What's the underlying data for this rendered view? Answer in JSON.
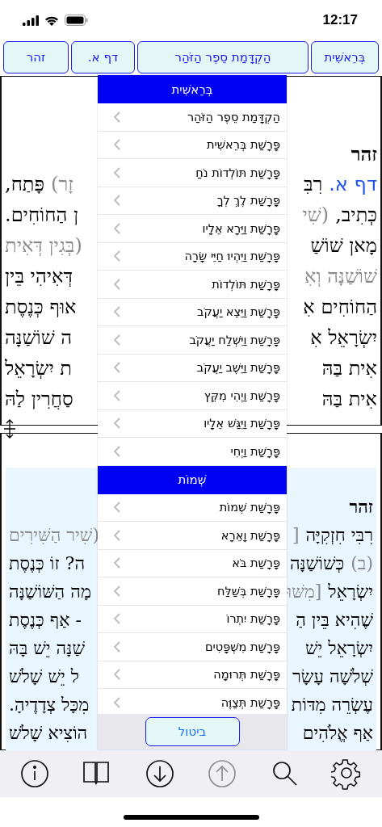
{
  "status_bar": {
    "time": "12:17"
  },
  "nav_buttons": [
    {
      "label": "בְּרֵאשִׁית"
    },
    {
      "label": "הַקְדָּמַת סֵפֶר הַזֹּהַר"
    },
    {
      "label": "דף א."
    },
    {
      "label": "זהר"
    }
  ],
  "upper_pane": {
    "lines": [
      {
        "right": [
          {
            "kind": "heading",
            "text": "זהר"
          }
        ]
      },
      {
        "right": [
          {
            "kind": "ref",
            "text": "דף א."
          },
          {
            "kind": "text",
            "text": "רִבִּ"
          }
        ],
        "left": [
          {
            "kind": "note",
            "text": "זָר)"
          },
          {
            "kind": "text",
            "text": "פָּתַח,"
          }
        ]
      },
      {
        "right": [
          {
            "kind": "text",
            "text": "כְּתִיב,"
          },
          {
            "kind": "note",
            "text": "(שִׁי"
          }
        ],
        "left": [
          {
            "kind": "text",
            "text": "ן הַחוֹחִים."
          }
        ]
      },
      {
        "right": [
          {
            "kind": "text",
            "text": "מָאן שׁוֹשַׁ"
          }
        ],
        "left": [
          {
            "kind": "note",
            "text": "(בְּגִין דְּאִית"
          }
        ]
      },
      {
        "right": [
          {
            "kind": "note",
            "text": "שׁוֹשַׁנָּה וְאִ"
          }
        ],
        "left": [
          {
            "kind": "text",
            "text": "דְּאִיהִי בֵּין"
          }
        ]
      },
      {
        "right": [
          {
            "kind": "text",
            "text": "הַחוֹחִים אִ"
          }
        ],
        "left": [
          {
            "kind": "text",
            "text": "אוּף כְּנֶסֶת"
          }
        ]
      },
      {
        "right": [
          {
            "kind": "text",
            "text": "יִשְׂרָאֵל אִ"
          }
        ],
        "left": [
          {
            "kind": "text",
            "text": "ה שׁוֹשַׁנָּה"
          }
        ]
      },
      {
        "right": [
          {
            "kind": "text",
            "text": "אִית בַּהּ"
          }
        ],
        "left": [
          {
            "kind": "text",
            "text": "ת יִשְׂרָאֵל"
          }
        ]
      },
      {
        "right": [
          {
            "kind": "text",
            "text": "אִית בַּהּ"
          }
        ],
        "left": [
          {
            "kind": "text",
            "text": "סַחֲרִין לַהּ"
          }
        ]
      }
    ]
  },
  "lower_pane": {
    "lines": [
      {
        "right": [
          {
            "kind": "heading",
            "text": "זהר"
          }
        ]
      },
      {
        "right": [
          {
            "kind": "text",
            "text": "רִבִּי חִזְקִיָּה"
          },
          {
            "kind": "note",
            "text": "["
          }
        ],
        "left": [
          {
            "kind": "note",
            "text": "(שִׁיר הַשִּׁירִים"
          }
        ]
      },
      {
        "right": [
          {
            "kind": "note",
            "text": "(ב)"
          },
          {
            "kind": "text",
            "text": "כְּשׁוֹשַׁנָּה"
          }
        ],
        "left": [
          {
            "kind": "text",
            "text": "ה? זוֹ כְּנֶסֶת"
          }
        ]
      },
      {
        "right": [
          {
            "kind": "text",
            "text": "יִשְׂרָאֵל"
          },
          {
            "kind": "note",
            "text": "[מִשּׁוּ"
          }
        ],
        "left": [
          {
            "kind": "text",
            "text": "מָה הַשּׁוֹשַׁנָּה"
          }
        ]
      },
      {
        "right": [
          {
            "kind": "text",
            "text": "שֶׁהִיא בֵּין הַ"
          }
        ],
        "left": [
          {
            "kind": "text",
            "text": "- אַף כְּנֶסֶת"
          }
        ]
      },
      {
        "right": [
          {
            "kind": "text",
            "text": "יִשְׂרָאֵל יֵשׁ"
          }
        ],
        "left": [
          {
            "kind": "text",
            "text": "שַׁנָּה יֵשׁ בָּהּ"
          }
        ]
      },
      {
        "right": [
          {
            "kind": "text",
            "text": "שְׁלֹשָׁה עָשָׂר"
          }
        ],
        "left": [
          {
            "kind": "text",
            "text": "ל יֵשׁ שָׁלֹשׁ"
          }
        ]
      },
      {
        "right": [
          {
            "kind": "text",
            "text": "עֶשְׂרֵה מִדּוֹת"
          }
        ],
        "left": [
          {
            "kind": "text",
            "text": "מִכָּל צְדָדֶיהָ."
          }
        ]
      },
      {
        "right": [
          {
            "kind": "text",
            "text": "אַף אֱלֹהִים"
          }
        ],
        "left": [
          {
            "kind": "text",
            "text": "הוֹצִיא שָׁלֹשׁ"
          }
        ]
      }
    ]
  },
  "menu": {
    "sections": [
      {
        "title": "בְּרֵאשִׁית",
        "items": [
          "הַקְדָּמַת סֵפֶר הַזֹּהַר",
          "פָּרָשַׁת בְּרֵאשִׁית",
          "פָּרָשַׁת תּוֹלְדוֹת נֹחַ",
          "פָּרָשַׁת לֶךְ לְךָ",
          "פָּרָשַׁת וַיֵּרָא אֵלָיו",
          "פָּרָשַׁת וַיִּהְיוּ חַיֵּי שָׂרָה",
          "פָּרָשַׁת תּוֹלְדוֹת",
          "פָּרָשַׁת וַיֵּצֵא יַעֲקֹב",
          "פָּרָשַׁת וַיִּשְׁלַח יַעֲקֹב",
          "פָּרָשַׁת וַיֵּשֶׁב יַעֲקֹב",
          "פָּרָשַׁת וַיְהִי מִקֵּץ",
          "פָּרָשַׁת וַיִּגַּשׁ אֵלָיו",
          "פָּרָשַׁת וַיְחִי"
        ]
      },
      {
        "title": "שְׁמוֹת",
        "items": [
          "פָּרָשַׁת שְׁמוֹת",
          "פָּרָשַׁת וָאֵרָא",
          "פָּרָשַׁת בֹּא",
          "פָּרָשַׁת בְּשַׁלַּח",
          "פָּרָשַׁת יִתְרוֹ",
          "פָּרָשַׁת מִשְׁפָּטִים",
          "פָּרָשַׁת תְּרוּמָה",
          "פָּרָשַׁת תְּצַוֶּה"
        ]
      }
    ],
    "cancel": "ביטול"
  },
  "toolbar": [
    {
      "kind": "info",
      "disabled": false
    },
    {
      "kind": "book",
      "disabled": false
    },
    {
      "kind": "down",
      "disabled": false
    },
    {
      "kind": "up",
      "disabled": true
    },
    {
      "kind": "search",
      "disabled": false
    },
    {
      "kind": "settings",
      "disabled": false
    }
  ]
}
